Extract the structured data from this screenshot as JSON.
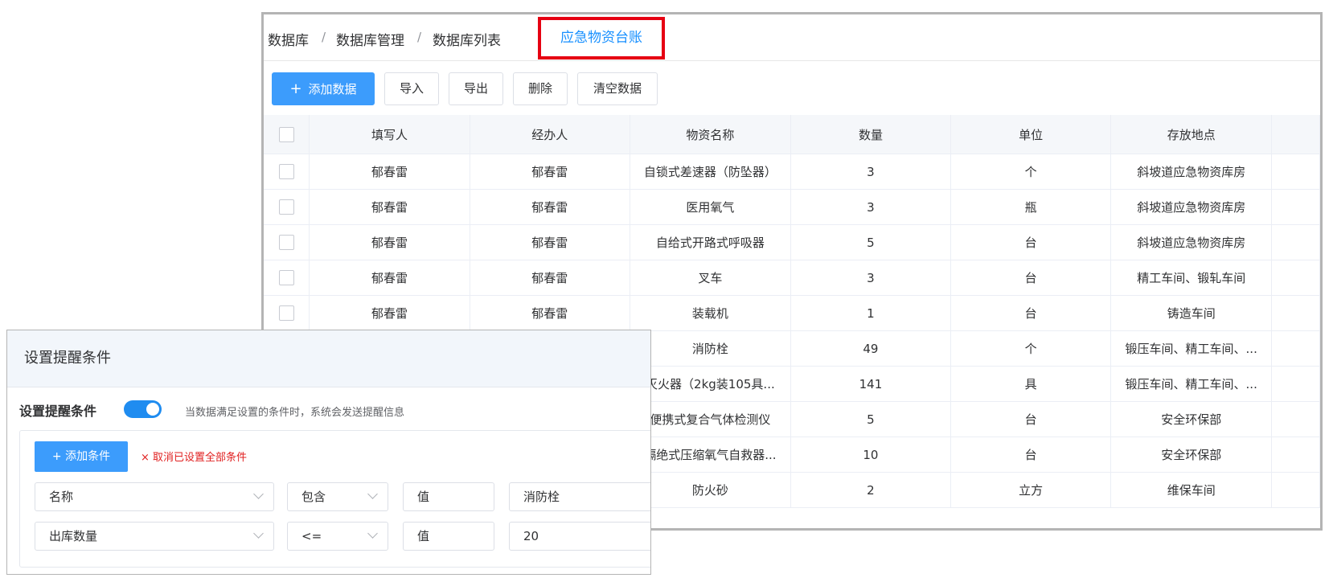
{
  "breadcrumb": {
    "items": [
      "数据库",
      "数据库管理",
      "数据库列表"
    ],
    "separator": "/",
    "current": "应急物资台账"
  },
  "toolbar": {
    "add_icon": "+",
    "add_label": "添加数据",
    "import_label": "导入",
    "export_label": "导出",
    "delete_label": "删除",
    "clear_label": "清空数据"
  },
  "table": {
    "columns": [
      "填写人",
      "经办人",
      "物资名称",
      "数量",
      "单位",
      "存放地点"
    ],
    "rows": [
      [
        "郁春雷",
        "郁春雷",
        "自锁式差速器（防坠器）",
        "3",
        "个",
        "斜坡道应急物资库房"
      ],
      [
        "郁春雷",
        "郁春雷",
        "医用氧气",
        "3",
        "瓶",
        "斜坡道应急物资库房"
      ],
      [
        "郁春雷",
        "郁春雷",
        "自给式开路式呼吸器",
        "5",
        "台",
        "斜坡道应急物资库房"
      ],
      [
        "郁春雷",
        "郁春雷",
        "叉车",
        "3",
        "台",
        "精工车间、锻轧车间"
      ],
      [
        "郁春雷",
        "郁春雷",
        "装载机",
        "1",
        "台",
        "铸造车间"
      ],
      [
        "",
        "",
        "消防栓",
        "49",
        "个",
        "锻压车间、精工车间、..."
      ],
      [
        "",
        "",
        "灭火器（2kg装105具...",
        "141",
        "具",
        "锻压车间、精工车间、..."
      ],
      [
        "",
        "",
        "便携式复合气体检测仪",
        "5",
        "台",
        "安全环保部"
      ],
      [
        "",
        "",
        "隔绝式压缩氧气自救器...",
        "10",
        "台",
        "安全环保部"
      ],
      [
        "",
        "",
        "防火砂",
        "2",
        "立方",
        "维保车间"
      ]
    ]
  },
  "dialog": {
    "title": "设置提醒条件",
    "toggle_label": "设置提醒条件",
    "toggle_on": true,
    "toggle_hint": "当数据满足设置的条件时，系统会发送提醒信息",
    "add_condition_label": "+ 添加条件",
    "clear_conditions_label": "× 取消已设置全部条件",
    "conditions": [
      {
        "field": "名称",
        "operator": "包含",
        "type": "值",
        "value": "消防栓"
      },
      {
        "field": "出库数量",
        "operator": "<=",
        "type": "值",
        "value": "20"
      }
    ]
  },
  "colors": {
    "primary": "#3c9cfc",
    "switch_on": "#1f8cf0",
    "highlight_border": "#e60012",
    "danger_text": "#e02020",
    "link_blue": "#1890ff"
  },
  "icons": [
    "plus-icon",
    "checkbox-icon",
    "chevron-down-icon",
    "close-icon"
  ]
}
